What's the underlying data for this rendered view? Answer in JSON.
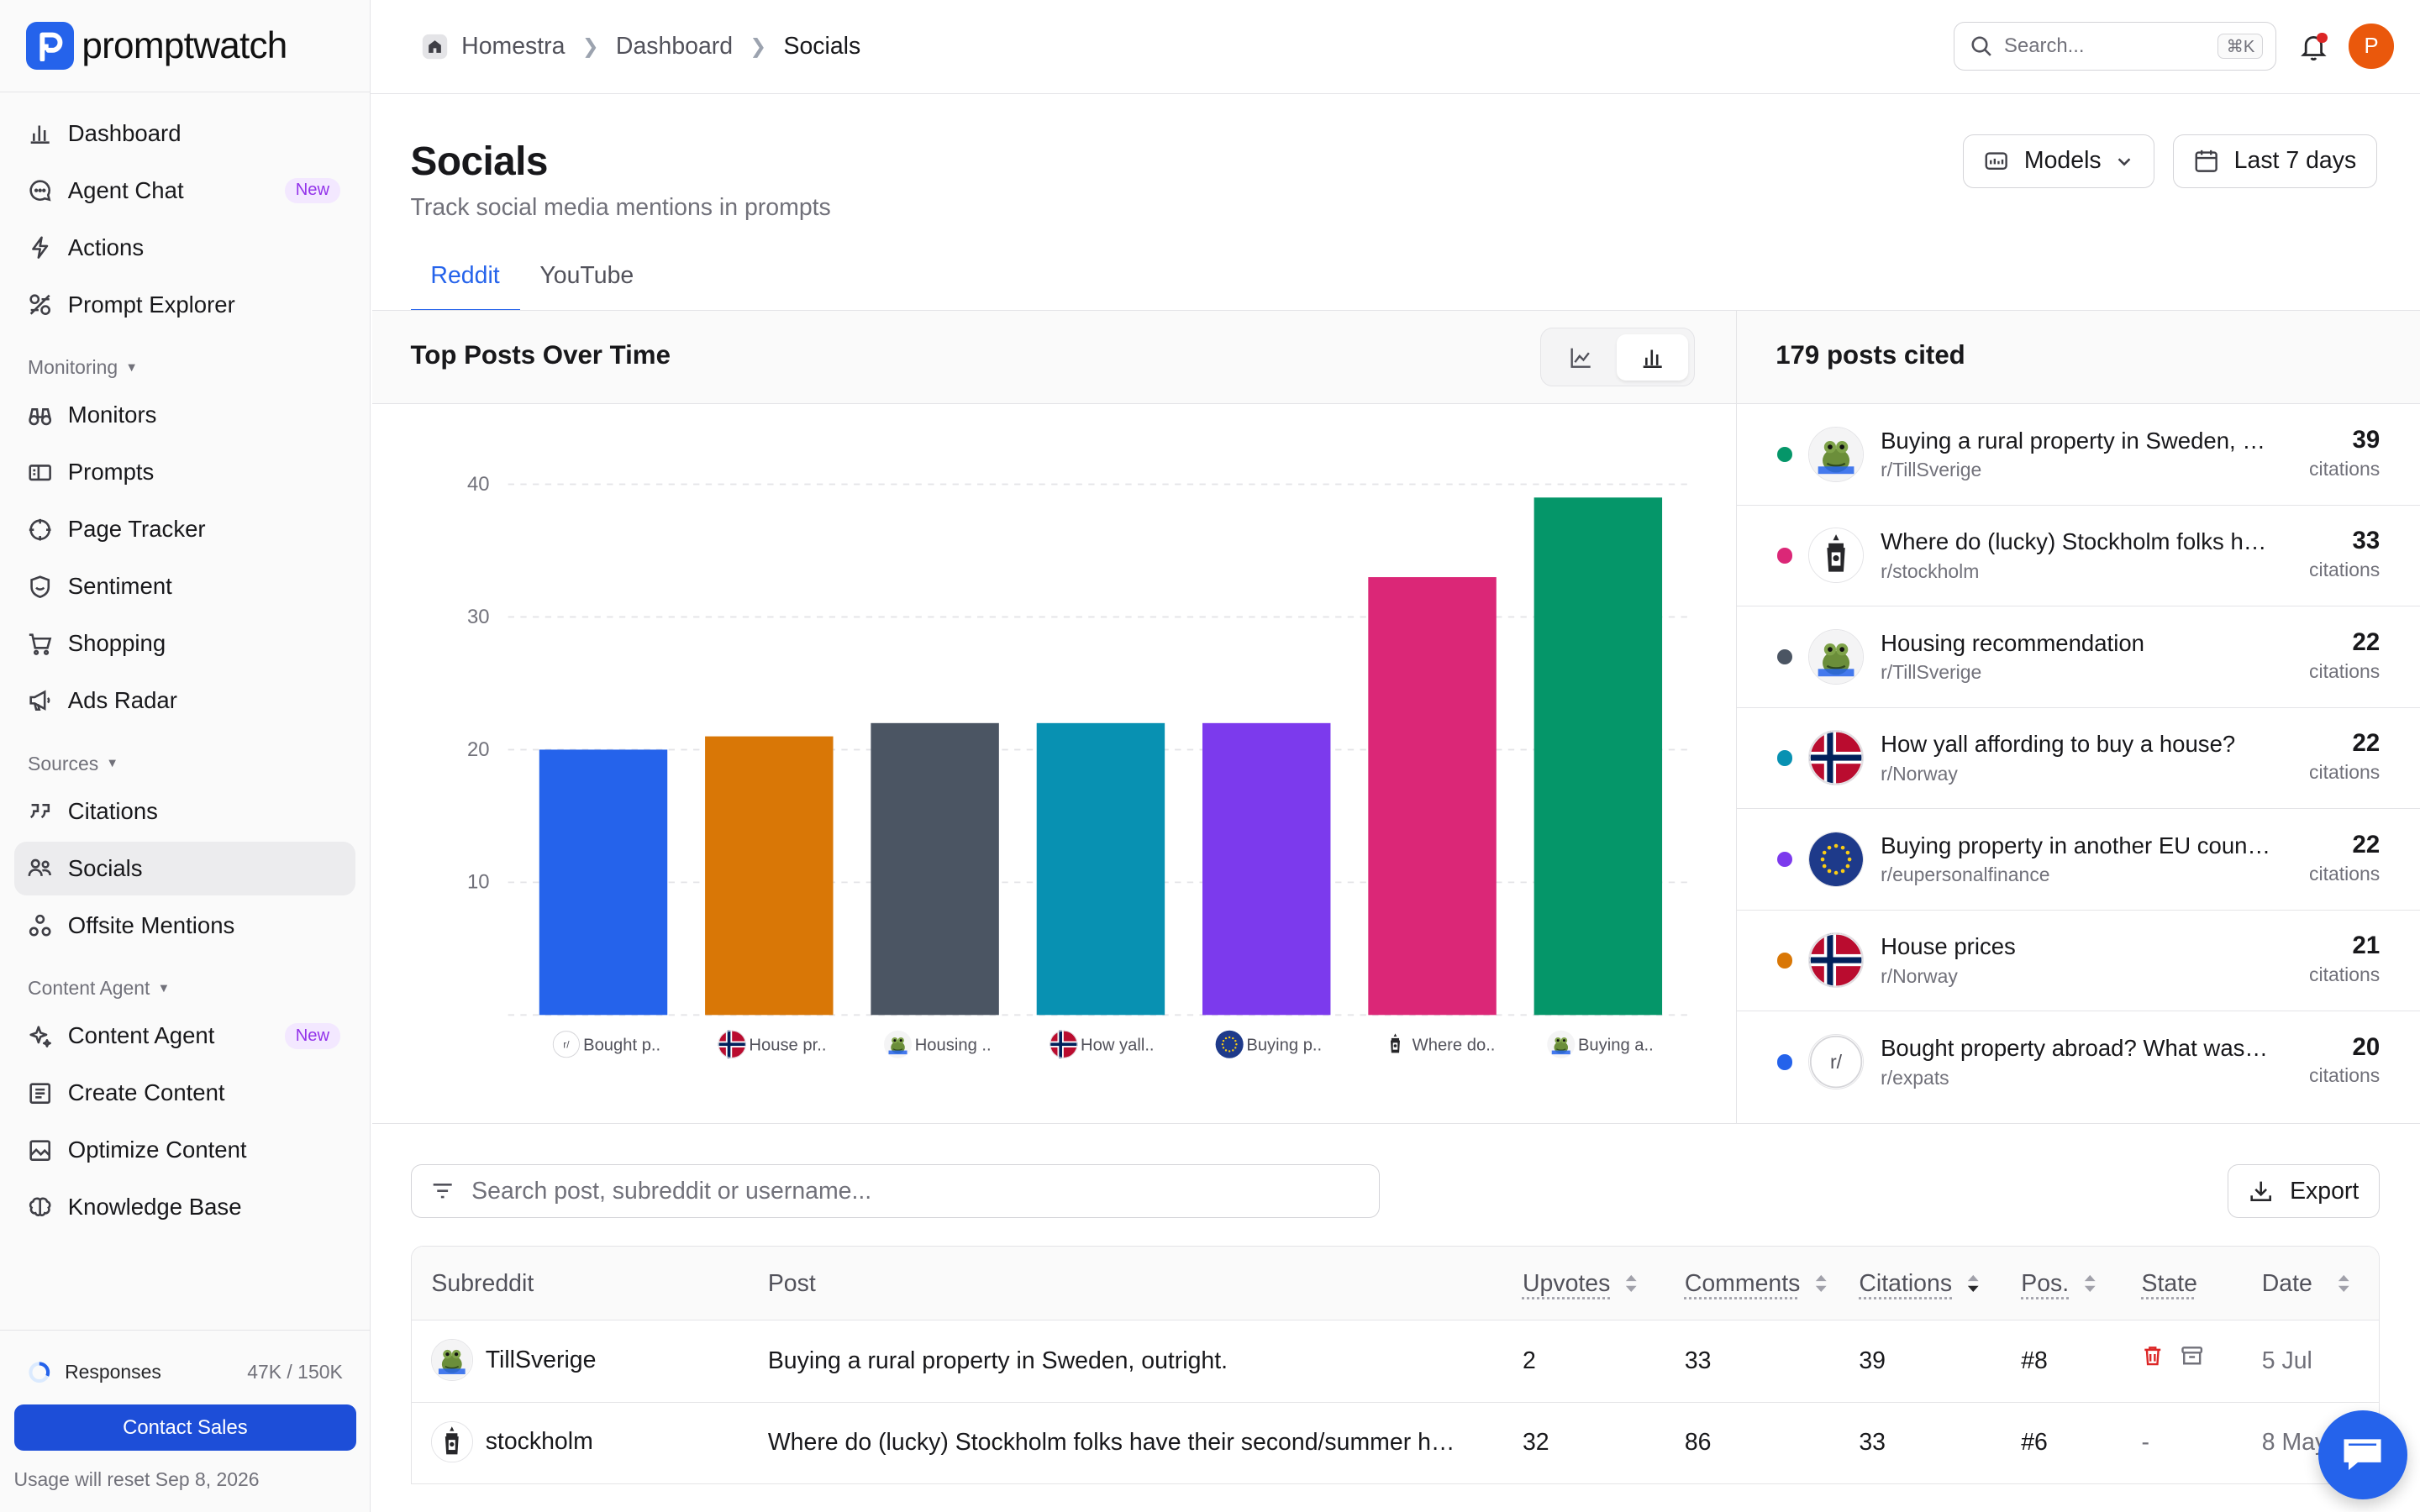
{
  "app": {
    "name": "promptwatch"
  },
  "sidebar": {
    "top_items": [
      {
        "label": "Dashboard",
        "icon": "bar-chart-icon"
      },
      {
        "label": "Agent Chat",
        "icon": "chat-icon",
        "badge": "New"
      },
      {
        "label": "Actions",
        "icon": "lightning-icon"
      },
      {
        "label": "Prompt Explorer",
        "icon": "explore-icon"
      }
    ],
    "sections": [
      {
        "title": "Monitoring",
        "items": [
          {
            "label": "Monitors",
            "icon": "binoculars-icon"
          },
          {
            "label": "Prompts",
            "icon": "prompt-icon"
          },
          {
            "label": "Page Tracker",
            "icon": "crosshair-icon"
          },
          {
            "label": "Sentiment",
            "icon": "shield-smile-icon"
          },
          {
            "label": "Shopping",
            "icon": "cart-icon"
          },
          {
            "label": "Ads Radar",
            "icon": "megaphone-icon"
          }
        ]
      },
      {
        "title": "Sources",
        "items": [
          {
            "label": "Citations",
            "icon": "quote-icon"
          },
          {
            "label": "Socials",
            "icon": "users-icon",
            "active": true
          },
          {
            "label": "Offsite Mentions",
            "icon": "nodes-icon"
          }
        ]
      },
      {
        "title": "Content Agent",
        "items": [
          {
            "label": "Content Agent",
            "icon": "sparkle-icon",
            "badge": "New"
          },
          {
            "label": "Create Content",
            "icon": "document-icon"
          },
          {
            "label": "Optimize Content",
            "icon": "image-edit-icon"
          },
          {
            "label": "Knowledge Base",
            "icon": "brain-icon"
          }
        ]
      }
    ],
    "footer": {
      "responses_label": "Responses",
      "responses_value": "47K / 150K",
      "responses_fraction": 0.313,
      "contact_label": "Contact Sales",
      "reset_note": "Usage will reset Sep 8, 2026"
    }
  },
  "topbar": {
    "breadcrumb": [
      "Homestra",
      "Dashboard",
      "Socials"
    ],
    "search_placeholder": "Search...",
    "search_shortcut": "⌘K",
    "avatar_letter": "P"
  },
  "header": {
    "title": "Socials",
    "subtitle": "Track social media mentions in prompts",
    "models_label": "Models",
    "date_label": "Last 7 days",
    "tabs": [
      {
        "label": "Reddit",
        "active": true
      },
      {
        "label": "YouTube"
      }
    ]
  },
  "chart_panel": {
    "title": "Top Posts Over Time"
  },
  "chart_data": {
    "type": "bar",
    "title": "Top Posts Over Time",
    "categories": [
      "Bought p..",
      "House pr..",
      "Housing ..",
      "How yall..",
      "Buying p..",
      "Where do..",
      "Buying a.."
    ],
    "values": [
      20,
      21,
      22,
      22,
      22,
      33,
      39
    ],
    "colors": [
      "#2563eb",
      "#d97706",
      "#4b5563",
      "#0891b2",
      "#7c3aed",
      "#db2777",
      "#059669"
    ],
    "category_icons": [
      "r-slash",
      "norway-flag",
      "frog-avatar",
      "norway-flag",
      "eu-flag",
      "stockholm-avatar",
      "frog-avatar"
    ],
    "y_ticks": [
      10,
      20,
      30,
      40
    ],
    "ylim": [
      0,
      40
    ],
    "grid": true
  },
  "posts_panel": {
    "title": "179 posts cited",
    "unit_label": "citations",
    "items": [
      {
        "title": "Buying a rural property in Sweden, outright.",
        "sub": "r/TillSverige",
        "count": "39",
        "dot": "#059669",
        "avatar": "frog"
      },
      {
        "title": "Where do (lucky) Stockholm folks have their second/summer homes?",
        "sub": "r/stockholm",
        "count": "33",
        "dot": "#db2777",
        "avatar": "stockholm"
      },
      {
        "title": "Housing recommendation",
        "sub": "r/TillSverige",
        "count": "22",
        "dot": "#4b5563",
        "avatar": "frog"
      },
      {
        "title": "How yall affording to buy a house?",
        "sub": "r/Norway",
        "count": "22",
        "dot": "#0891b2",
        "avatar": "norway"
      },
      {
        "title": "Buying property in another EU country",
        "sub": "r/eupersonalfinance",
        "count": "22",
        "dot": "#7c3aed",
        "avatar": "eu"
      },
      {
        "title": "House prices",
        "sub": "r/Norway",
        "count": "21",
        "dot": "#d97706",
        "avatar": "norway"
      },
      {
        "title": "Bought property abroad? What was it like?",
        "sub": "r/expats",
        "count": "20",
        "dot": "#2563eb",
        "avatar": "rslash",
        "avatar_text": "r/"
      }
    ]
  },
  "table": {
    "search_placeholder": "Search post, subreddit or username...",
    "export_label": "Export",
    "columns": [
      "Subreddit",
      "Post",
      "Upvotes",
      "Comments",
      "Citations",
      "Pos.",
      "State",
      "Date"
    ],
    "rows": [
      {
        "subreddit": "TillSverige",
        "post": "Buying a rural property in Sweden, outright.",
        "upvotes": "2",
        "comments": "33",
        "citations": "39",
        "pos": "#8",
        "state": "icons",
        "date": "5 Jul",
        "avatar": "frog"
      },
      {
        "subreddit": "stockholm",
        "post": "Where do (lucky) Stockholm folks have their second/summer homes?",
        "upvotes": "32",
        "comments": "86",
        "citations": "33",
        "pos": "#6",
        "state": "-",
        "date": "8 May",
        "avatar": "stockholm"
      }
    ]
  }
}
